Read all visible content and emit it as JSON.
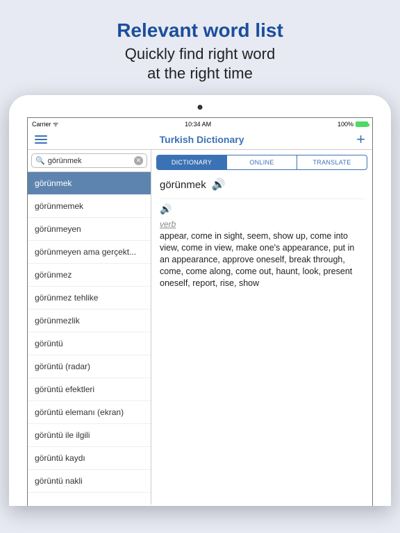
{
  "promo": {
    "headline": "Relevant word list",
    "sub1": "Quickly find right word",
    "sub2": "at the right time"
  },
  "statusbar": {
    "carrier": "Carrier",
    "time": "10:34 AM",
    "battery": "100%"
  },
  "navbar": {
    "title": "Turkish Dictionary"
  },
  "search": {
    "value": "görünmek"
  },
  "wordlist": [
    "görünmek",
    "görünmemek",
    "görünmeyen",
    "görünmeyen ama gerçekt...",
    "görünmez",
    "görünmez tehlike",
    "görünmezlik",
    "görüntü",
    "görüntü (radar)",
    "görüntü efektleri",
    "görüntü elemanı (ekran)",
    "görüntü ile ilgili",
    "görüntü kaydı",
    "görüntü nakli"
  ],
  "selected_index": 0,
  "tabs": [
    "DICTIONARY",
    "ONLINE",
    "TRANSLATE"
  ],
  "active_tab": 0,
  "entry": {
    "headword": "görünmek",
    "pos": "verb",
    "definition": "appear, come in sight, seem, show up, come into view, come in view, make one's appearance, put in an appearance, approve oneself, break through, come, come along, come out, haunt, look, present oneself, report, rise, show"
  }
}
